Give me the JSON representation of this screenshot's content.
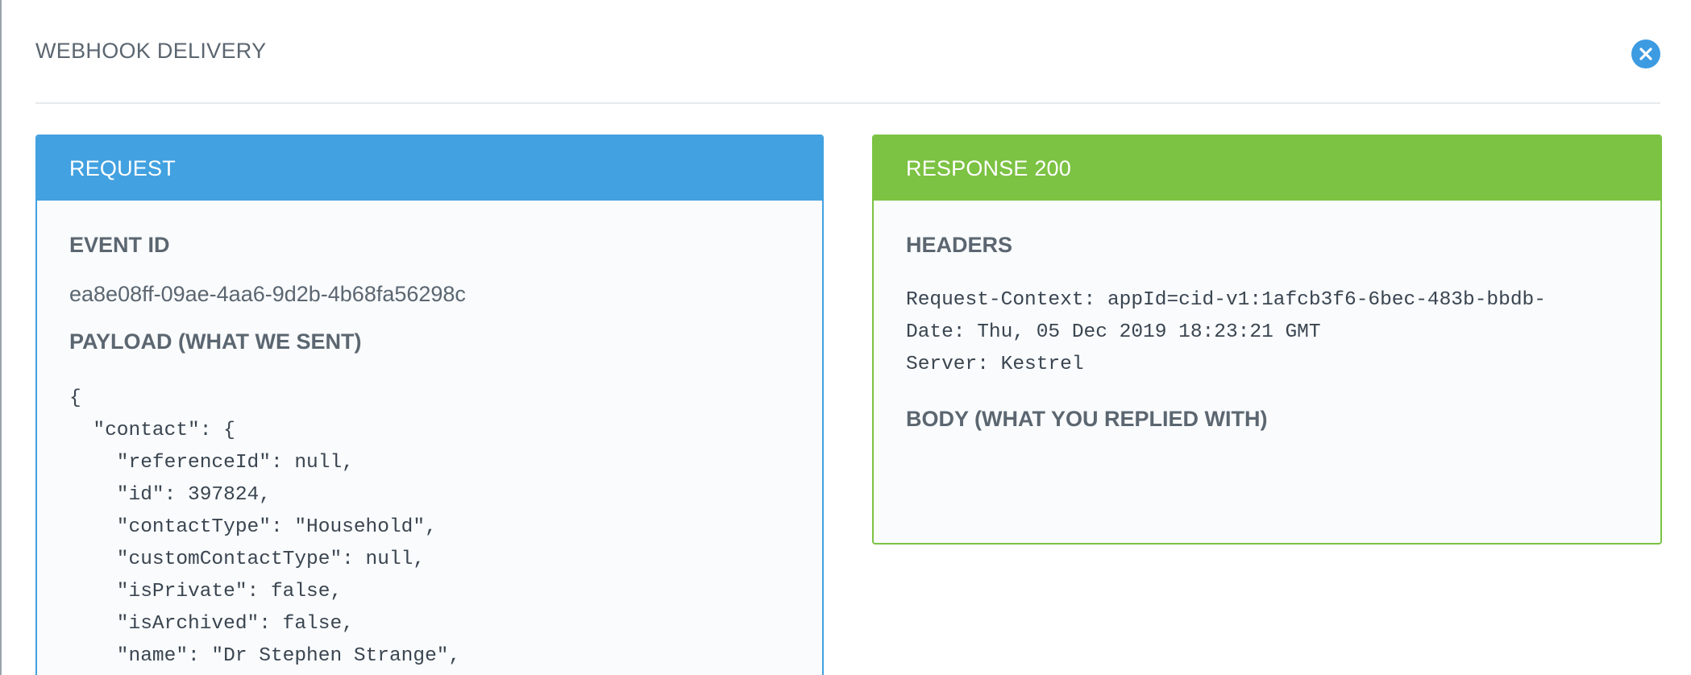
{
  "modal": {
    "title": "WEBHOOK DELIVERY",
    "close_icon": "close-circle-icon"
  },
  "request": {
    "header": "REQUEST",
    "event_id_label": "EVENT ID",
    "event_id": "ea8e08ff-09ae-4aa6-9d2b-4b68fa56298c",
    "payload_label": "PAYLOAD (WHAT WE SENT)",
    "payload_lines": [
      "{",
      "  \"contact\": {",
      "    \"referenceId\": null,",
      "    \"id\": 397824,",
      "    \"contactType\": \"Household\",",
      "    \"customContactType\": null,",
      "    \"isPrivate\": false,",
      "    \"isArchived\": false,",
      "    \"name\": \"Dr Stephen Strange\","
    ]
  },
  "response": {
    "header": "RESPONSE 200",
    "headers_label": "HEADERS",
    "header_lines": [
      "Request-Context: appId=cid-v1:1afcb3f6-6bec-483b-bbdb-",
      "Date: Thu, 05 Dec 2019 18:23:21 GMT",
      "Server: Kestrel"
    ],
    "body_label": "BODY (WHAT YOU REPLIED WITH)"
  },
  "colors": {
    "request_accent": "#42a1e0",
    "response_accent": "#7cc243",
    "close_button": "#3d9be2"
  }
}
